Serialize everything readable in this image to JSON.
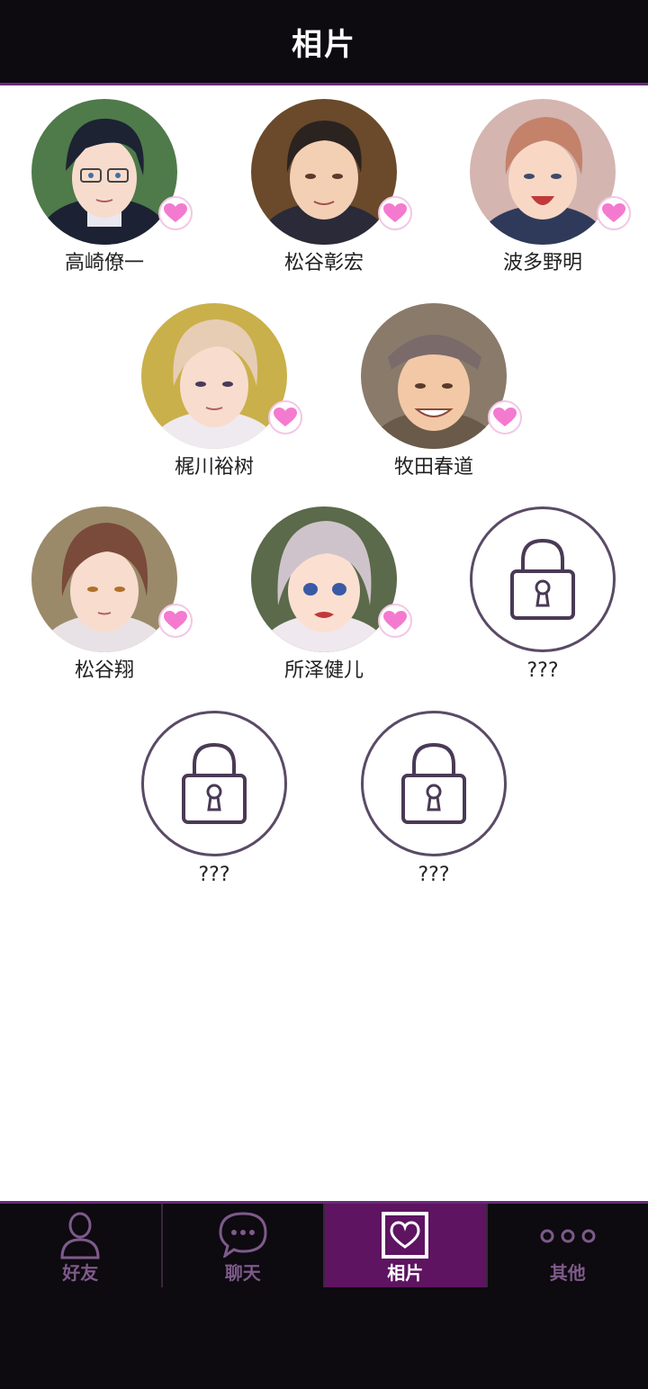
{
  "header": {
    "title": "相片"
  },
  "contacts": [
    {
      "name": "高崎僚一",
      "locked": false
    },
    {
      "name": "松谷彰宏",
      "locked": false
    },
    {
      "name": "波多野明",
      "locked": false
    },
    {
      "name": "梶川裕树",
      "locked": false
    },
    {
      "name": "牧田春道",
      "locked": false
    },
    {
      "name": "松谷翔",
      "locked": false
    },
    {
      "name": "所泽健儿",
      "locked": false
    },
    {
      "name": "???",
      "locked": true
    },
    {
      "name": "???",
      "locked": true
    },
    {
      "name": "???",
      "locked": true
    }
  ],
  "tabs": [
    {
      "label": "好友",
      "icon": "person-icon",
      "active": false
    },
    {
      "label": "聊天",
      "icon": "chat-bubble-icon",
      "active": false
    },
    {
      "label": "相片",
      "icon": "photo-heart-icon",
      "active": true
    },
    {
      "label": "其他",
      "icon": "more-dots-icon",
      "active": false
    }
  ],
  "colors": {
    "header_bg": "#0d0a10",
    "accent": "#6b2a7a",
    "active_tab": "#5e1461",
    "heart": "#f47ad0",
    "inactive_tab_text": "#7e5a8a"
  }
}
